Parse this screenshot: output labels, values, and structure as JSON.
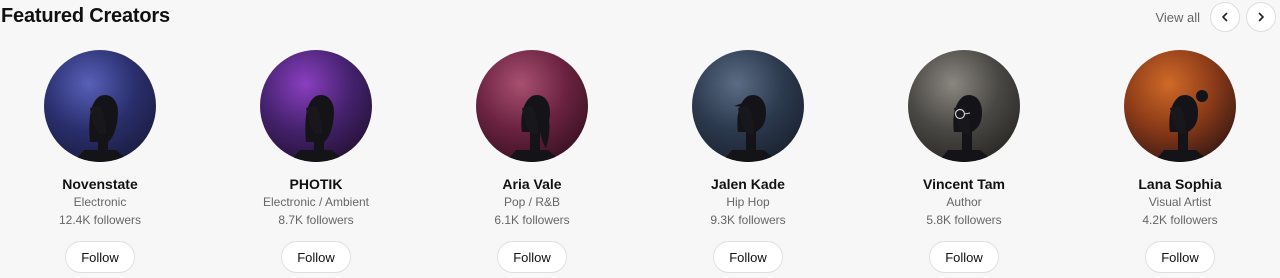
{
  "header": {
    "title": "Featured Creators",
    "view_all": "View all",
    "prev_icon": "chevron-left-icon",
    "next_icon": "chevron-right-icon"
  },
  "creators": [
    {
      "name": "Novenstate",
      "genre": "Electronic",
      "followers": "12.4K followers",
      "follow_label": "Follow",
      "colors": {
        "base": "#2a2f6e",
        "glow": "#5860b8",
        "dark": "#1b1d40"
      },
      "figure": "long-hair"
    },
    {
      "name": "PHOTIK",
      "genre": "Electronic / Ambient",
      "followers": "8.7K followers",
      "follow_label": "Follow",
      "colors": {
        "base": "#45226e",
        "glow": "#8a3fc0",
        "dark": "#261238"
      },
      "figure": "long-hair"
    },
    {
      "name": "Aria Vale",
      "genre": "Pop / R&B",
      "followers": "6.1K followers",
      "follow_label": "Follow",
      "colors": {
        "base": "#6a2240",
        "glow": "#a85070",
        "dark": "#3a1222"
      },
      "figure": "ponytail"
    },
    {
      "name": "Jalen Kade",
      "genre": "Hip Hop",
      "followers": "9.3K followers",
      "follow_label": "Follow",
      "colors": {
        "base": "#2c3a4e",
        "glow": "#5a6c84",
        "dark": "#1a2230"
      },
      "figure": "cap"
    },
    {
      "name": "Vincent Tam",
      "genre": "Author",
      "followers": "5.8K followers",
      "follow_label": "Follow",
      "colors": {
        "base": "#4a4844",
        "glow": "#8a8680",
        "dark": "#2a2826"
      },
      "figure": "glasses"
    },
    {
      "name": "Lana Sophia",
      "genre": "Visual Artist",
      "followers": "4.2K followers",
      "follow_label": "Follow",
      "colors": {
        "base": "#8a3a18",
        "glow": "#d06a28",
        "dark": "#3a1a14"
      },
      "figure": "bun"
    }
  ]
}
